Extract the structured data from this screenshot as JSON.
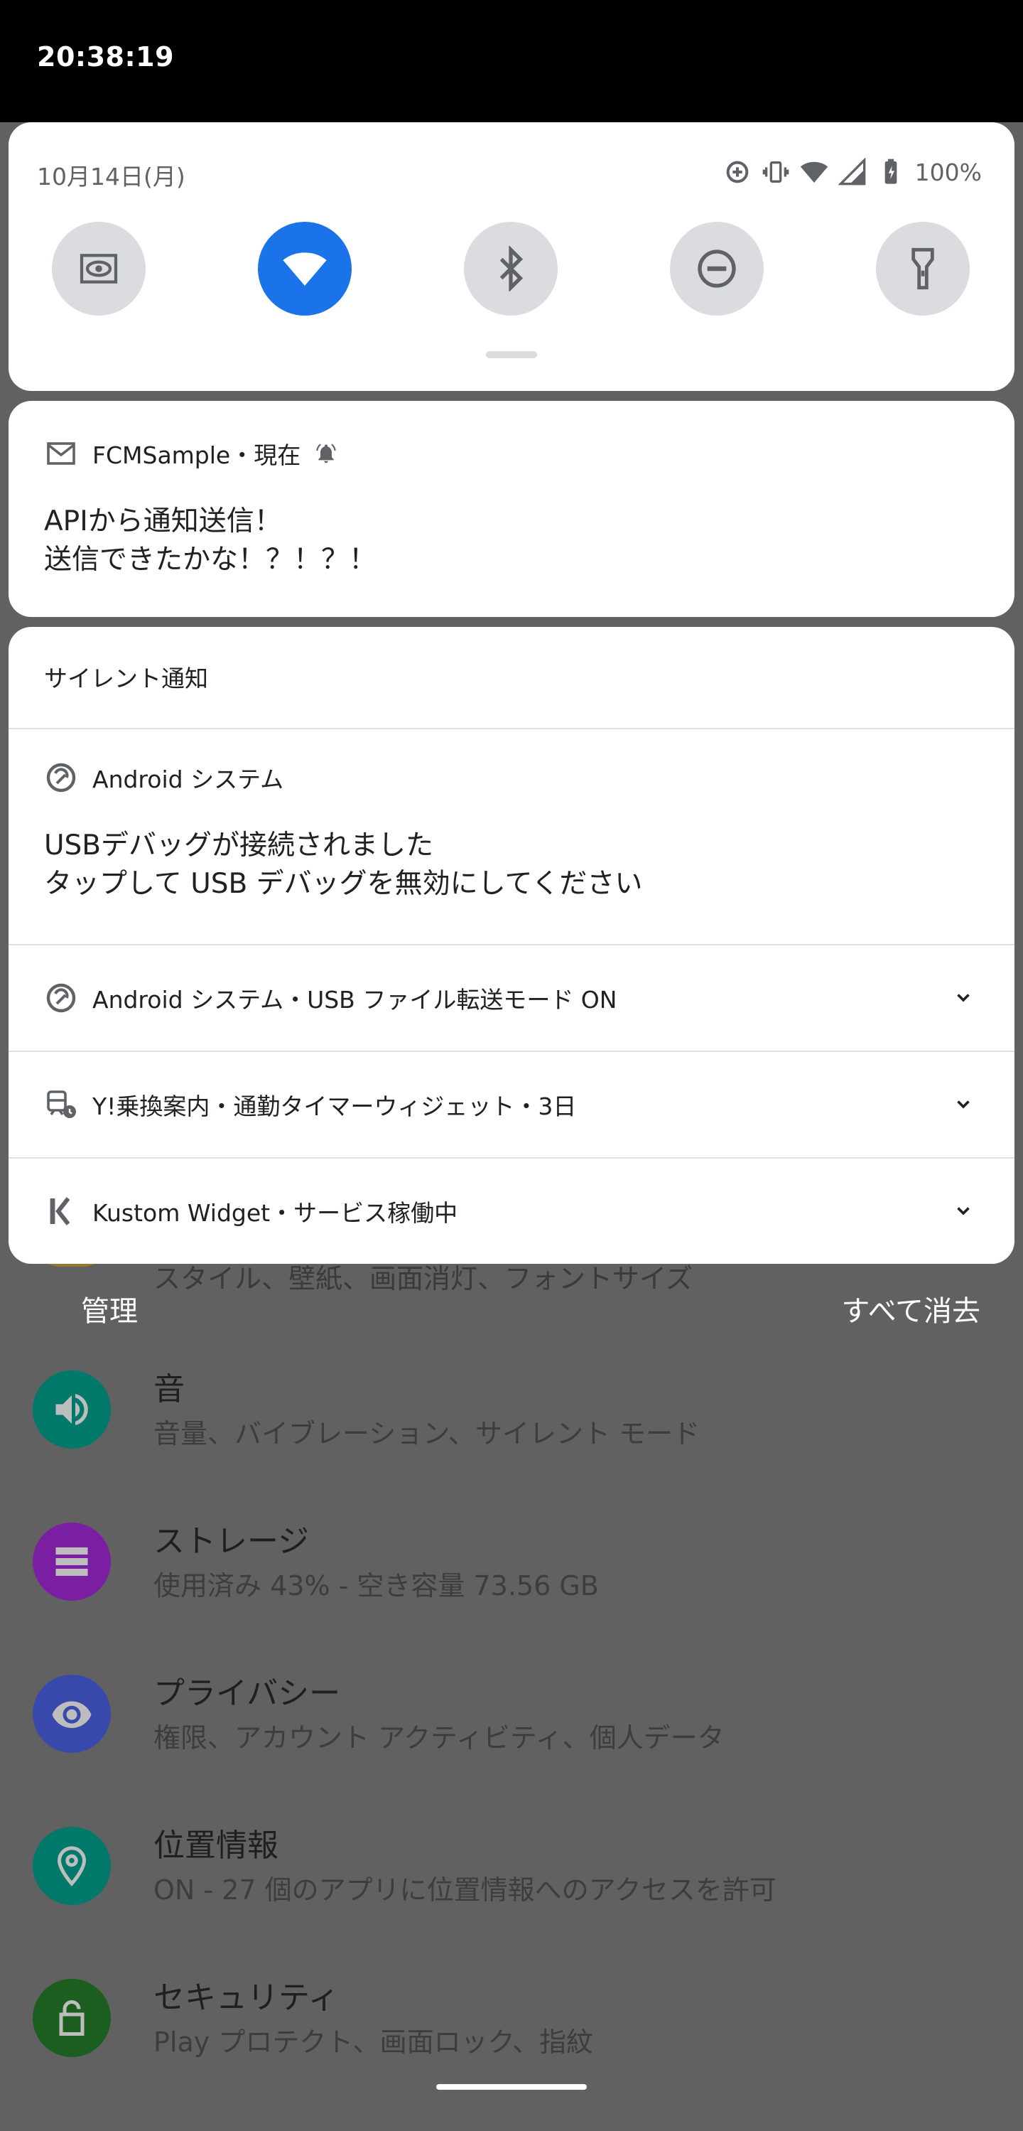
{
  "status_bar": {
    "time": "20:38:19"
  },
  "quick_settings": {
    "date": "10月14日(月)",
    "battery": "100%",
    "tiles": [
      {
        "name": "screen-saver",
        "active": false
      },
      {
        "name": "wifi",
        "active": true
      },
      {
        "name": "bluetooth",
        "active": false
      },
      {
        "name": "do-not-disturb",
        "active": false
      },
      {
        "name": "flashlight",
        "active": false
      }
    ]
  },
  "background": {
    "partial_1a": "...",
    "partial_1b": "",
    "partial_2": "",
    "partial_3": "スタイル、壁紙、画面消灯、フォントサイズ",
    "settings": [
      {
        "title": "音",
        "subtitle": "音量、バイブレーション、サイレント モード",
        "color": "#00796b"
      },
      {
        "title": "ストレージ",
        "subtitle": "使用済み 43% - 空き容量 73.56 GB",
        "color": "#8e24aa"
      },
      {
        "title": "プライバシー",
        "subtitle": "権限、アカウント アクティビティ、個人データ",
        "color": "#3f51b5"
      },
      {
        "title": "位置情報",
        "subtitle": "ON - 27 個のアプリに位置情報へのアクセスを許可",
        "color": "#00897b"
      },
      {
        "title": "セキュリティ",
        "subtitle": "Play プロテクト、画面ロック、指紋",
        "color": "#1b5e20"
      }
    ]
  },
  "notifications": {
    "fcm": {
      "app": "FCMSample・現在",
      "title": "APIから通知送信！",
      "body": "送信できたかな！？！？！"
    },
    "silent_header": "サイレント通知",
    "android_system": {
      "app": "Android システム",
      "title": "USBデバッグが接続されました",
      "body": "タップして USB デバッグを無効にしてください"
    },
    "collapsed": [
      {
        "text": "Android システム・USB ファイル転送モード ON"
      },
      {
        "text": "Y!乗換案内・通勤タイマーウィジェット・3日"
      },
      {
        "text": "Kustom Widget・サービス稼働中"
      }
    ]
  },
  "footer": {
    "manage": "管理",
    "clear_all": "すべて消去"
  }
}
